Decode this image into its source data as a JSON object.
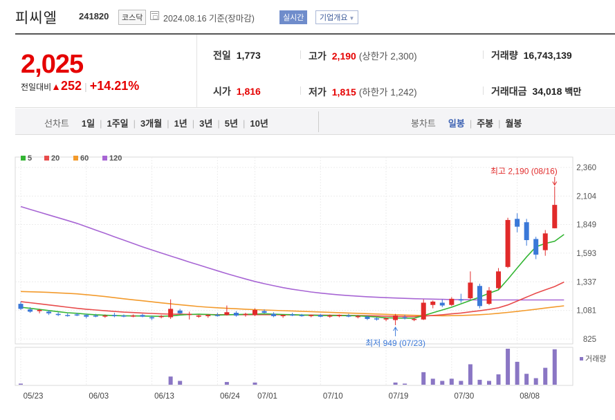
{
  "header": {
    "company": "피씨엘",
    "code": "241820",
    "market": "코스닥",
    "date": "2024.08.16 기준(장마감)",
    "realtime": "실시간",
    "overview": "기업개요"
  },
  "quote": {
    "price": "2,025",
    "change_label": "전일대비",
    "change_value": "252",
    "change_pct": "+14.21%",
    "prev_close_label": "전일",
    "prev_close": "1,773",
    "open_label": "시가",
    "open": "1,816",
    "high_label": "고가",
    "high": "2,190",
    "upper_limit": "(상한가 2,300)",
    "low_label": "저가",
    "low": "1,815",
    "lower_limit": "(하한가 1,242)",
    "volume_label": "거래량",
    "volume": "16,743,139",
    "amount_label": "거래대금",
    "amount": "34,018",
    "amount_unit": "백만"
  },
  "tabs": {
    "line_title": "선차트",
    "line_items": [
      "1일",
      "1주일",
      "3개월",
      "1년",
      "3년",
      "5년",
      "10년"
    ],
    "candle_title": "봉차트",
    "candle_items": [
      "일봉",
      "주봉",
      "월봉"
    ],
    "candle_selected": "일봉"
  },
  "chart_data": {
    "type": "candlestick",
    "legend": [
      {
        "name": "5",
        "color": "#33b533"
      },
      {
        "name": "20",
        "color": "#e84b4b"
      },
      {
        "name": "60",
        "color": "#f39a2b"
      },
      {
        "name": "120",
        "color": "#a765d4"
      }
    ],
    "y_ticks": [
      "2,360",
      "2,104",
      "1,849",
      "1,593",
      "1,337",
      "1,081",
      "825"
    ],
    "ylim": [
      825,
      2360
    ],
    "x_ticks": [
      {
        "i": 0,
        "label": "05/23"
      },
      {
        "i": 7,
        "label": "06/03"
      },
      {
        "i": 14,
        "label": "06/13"
      },
      {
        "i": 21,
        "label": "06/24"
      },
      {
        "i": 25,
        "label": "07/01"
      },
      {
        "i": 32,
        "label": "07/10"
      },
      {
        "i": 39,
        "label": "07/19"
      },
      {
        "i": 46,
        "label": "07/30"
      },
      {
        "i": 53,
        "label": "08/08"
      }
    ],
    "high_annotation": "최고 2,190 (08/16)",
    "low_annotation": "최저 949 (07/23)",
    "volume_label": "거래량",
    "candles": [
      {
        "o": 1140,
        "h": 1160,
        "l": 1085,
        "c": 1095
      },
      {
        "o": 1090,
        "h": 1110,
        "l": 1060,
        "c": 1070
      },
      {
        "o": 1075,
        "h": 1095,
        "l": 1055,
        "c": 1085
      },
      {
        "o": 1070,
        "h": 1085,
        "l": 1040,
        "c": 1055
      },
      {
        "o": 1050,
        "h": 1065,
        "l": 1030,
        "c": 1040
      },
      {
        "o": 1040,
        "h": 1055,
        "l": 1025,
        "c": 1035
      },
      {
        "o": 1045,
        "h": 1060,
        "l": 1030,
        "c": 1040
      },
      {
        "o": 1040,
        "h": 1050,
        "l": 1010,
        "c": 1025
      },
      {
        "o": 1035,
        "h": 1050,
        "l": 1020,
        "c": 1030
      },
      {
        "o": 1030,
        "h": 1045,
        "l": 1015,
        "c": 1035
      },
      {
        "o": 1040,
        "h": 1060,
        "l": 1020,
        "c": 1030
      },
      {
        "o": 1035,
        "h": 1045,
        "l": 1020,
        "c": 1030
      },
      {
        "o": 1030,
        "h": 1045,
        "l": 1020,
        "c": 1035
      },
      {
        "o": 1040,
        "h": 1050,
        "l": 1020,
        "c": 1025
      },
      {
        "o": 1020,
        "h": 1035,
        "l": 995,
        "c": 1010
      },
      {
        "o": 1025,
        "h": 1040,
        "l": 1010,
        "c": 1030
      },
      {
        "o": 1020,
        "h": 1180,
        "l": 1005,
        "c": 1095
      },
      {
        "o": 1080,
        "h": 1095,
        "l": 1050,
        "c": 1055
      },
      {
        "o": 1045,
        "h": 1070,
        "l": 1000,
        "c": 1050
      },
      {
        "o": 1025,
        "h": 1040,
        "l": 1015,
        "c": 1035
      },
      {
        "o": 1030,
        "h": 1045,
        "l": 1015,
        "c": 1040
      },
      {
        "o": 1040,
        "h": 1060,
        "l": 1025,
        "c": 1035
      },
      {
        "o": 1040,
        "h": 1125,
        "l": 1035,
        "c": 1065
      },
      {
        "o": 1060,
        "h": 1075,
        "l": 1025,
        "c": 1035
      },
      {
        "o": 1040,
        "h": 1060,
        "l": 1025,
        "c": 1050
      },
      {
        "o": 1040,
        "h": 1100,
        "l": 1030,
        "c": 1085
      },
      {
        "o": 1075,
        "h": 1090,
        "l": 1055,
        "c": 1060
      },
      {
        "o": 1050,
        "h": 1065,
        "l": 1020,
        "c": 1030
      },
      {
        "o": 1030,
        "h": 1045,
        "l": 1015,
        "c": 1040
      },
      {
        "o": 1045,
        "h": 1060,
        "l": 1030,
        "c": 1035
      },
      {
        "o": 1040,
        "h": 1050,
        "l": 1025,
        "c": 1030
      },
      {
        "o": 1030,
        "h": 1045,
        "l": 1020,
        "c": 1040
      },
      {
        "o": 1040,
        "h": 1050,
        "l": 1020,
        "c": 1025
      },
      {
        "o": 1030,
        "h": 1045,
        "l": 1015,
        "c": 1035
      },
      {
        "o": 1030,
        "h": 1045,
        "l": 1020,
        "c": 1040
      },
      {
        "o": 1035,
        "h": 1050,
        "l": 1020,
        "c": 1030
      },
      {
        "o": 1025,
        "h": 1040,
        "l": 1010,
        "c": 1030
      },
      {
        "o": 1025,
        "h": 1035,
        "l": 995,
        "c": 1005
      },
      {
        "o": 1010,
        "h": 1020,
        "l": 990,
        "c": 1000
      },
      {
        "o": 1000,
        "h": 1020,
        "l": 985,
        "c": 1010
      },
      {
        "o": 995,
        "h": 1050,
        "l": 949,
        "c": 1035
      },
      {
        "o": 1020,
        "h": 1040,
        "l": 1000,
        "c": 1010
      },
      {
        "o": 1000,
        "h": 1015,
        "l": 985,
        "c": 1005
      },
      {
        "o": 1000,
        "h": 1180,
        "l": 995,
        "c": 1150
      },
      {
        "o": 1130,
        "h": 1170,
        "l": 1100,
        "c": 1160
      },
      {
        "o": 1150,
        "h": 1180,
        "l": 1110,
        "c": 1125
      },
      {
        "o": 1130,
        "h": 1200,
        "l": 1120,
        "c": 1185
      },
      {
        "o": 1180,
        "h": 1230,
        "l": 1150,
        "c": 1170
      },
      {
        "o": 1190,
        "h": 1430,
        "l": 1180,
        "c": 1330
      },
      {
        "o": 1300,
        "h": 1320,
        "l": 1100,
        "c": 1120
      },
      {
        "o": 1140,
        "h": 1290,
        "l": 1130,
        "c": 1260
      },
      {
        "o": 1280,
        "h": 1460,
        "l": 1270,
        "c": 1430
      },
      {
        "o": 1470,
        "h": 1910,
        "l": 1460,
        "c": 1890
      },
      {
        "o": 1900,
        "h": 1950,
        "l": 1780,
        "c": 1830
      },
      {
        "o": 1870,
        "h": 1900,
        "l": 1660,
        "c": 1710
      },
      {
        "o": 1720,
        "h": 1740,
        "l": 1540,
        "c": 1580
      },
      {
        "o": 1620,
        "h": 1800,
        "l": 1570,
        "c": 1770
      },
      {
        "o": 1816,
        "h": 2190,
        "l": 1815,
        "c": 2025
      }
    ],
    "ma5": [
      1110,
      1100,
      1090,
      1080,
      1070,
      1060,
      1055,
      1048,
      1042,
      1038,
      1035,
      1033,
      1032,
      1031,
      1030,
      1028,
      1032,
      1040,
      1045,
      1048,
      1045,
      1040,
      1042,
      1044,
      1046,
      1048,
      1050,
      1048,
      1045,
      1043,
      1040,
      1038,
      1036,
      1035,
      1035,
      1034,
      1033,
      1028,
      1022,
      1015,
      1013,
      1012,
      1012,
      1035,
      1060,
      1085,
      1110,
      1140,
      1170,
      1200,
      1235,
      1265,
      1360,
      1460,
      1560,
      1650,
      1680,
      1700,
      1760
    ],
    "ma20": [
      1160,
      1150,
      1140,
      1130,
      1120,
      1110,
      1100,
      1092,
      1085,
      1078,
      1072,
      1066,
      1062,
      1058,
      1054,
      1050,
      1048,
      1047,
      1046,
      1045,
      1044,
      1043,
      1043,
      1043,
      1043,
      1043,
      1043,
      1043,
      1042,
      1041,
      1040,
      1040,
      1039,
      1038,
      1037,
      1036,
      1035,
      1034,
      1032,
      1030,
      1028,
      1027,
      1026,
      1030,
      1036,
      1042,
      1050,
      1058,
      1068,
      1078,
      1090,
      1105,
      1130,
      1165,
      1200,
      1235,
      1265,
      1295,
      1335
    ],
    "ma60": [
      1250,
      1248,
      1245,
      1242,
      1238,
      1234,
      1229,
      1222,
      1214,
      1205,
      1195,
      1185,
      1176,
      1167,
      1158,
      1149,
      1140,
      1132,
      1124,
      1116,
      1110,
      1105,
      1100,
      1096,
      1092,
      1088,
      1085,
      1082,
      1079,
      1076,
      1073,
      1070,
      1067,
      1064,
      1061,
      1058,
      1055,
      1052,
      1049,
      1046,
      1043,
      1040,
      1037,
      1035,
      1034,
      1033,
      1034,
      1036,
      1039,
      1043,
      1048,
      1055,
      1063,
      1072,
      1082,
      1092,
      1102,
      1112,
      1122
    ],
    "ma120": [
      2010,
      1985,
      1960,
      1935,
      1910,
      1885,
      1860,
      1830,
      1800,
      1770,
      1740,
      1710,
      1680,
      1650,
      1622,
      1595,
      1568,
      1541,
      1514,
      1488,
      1462,
      1436,
      1410,
      1386,
      1362,
      1340,
      1320,
      1302,
      1285,
      1270,
      1258,
      1246,
      1236,
      1228,
      1220,
      1214,
      1208,
      1203,
      1199,
      1195,
      1192,
      1189,
      1186,
      1184,
      1182,
      1180,
      1178,
      1177,
      1176,
      1175,
      1175,
      1175,
      1175,
      1175,
      1175,
      1175,
      1175,
      1175,
      1175
    ],
    "volume": [
      4,
      0,
      0,
      0,
      0,
      0,
      0,
      0,
      0,
      0,
      0,
      0,
      0,
      0,
      0,
      0,
      30,
      14,
      0,
      0,
      0,
      0,
      10,
      0,
      0,
      8,
      0,
      0,
      0,
      0,
      0,
      0,
      0,
      0,
      0,
      0,
      0,
      0,
      0,
      0,
      8,
      4,
      0,
      46,
      22,
      14,
      22,
      14,
      75,
      18,
      14,
      38,
      132,
      84,
      40,
      24,
      62,
      130
    ]
  }
}
